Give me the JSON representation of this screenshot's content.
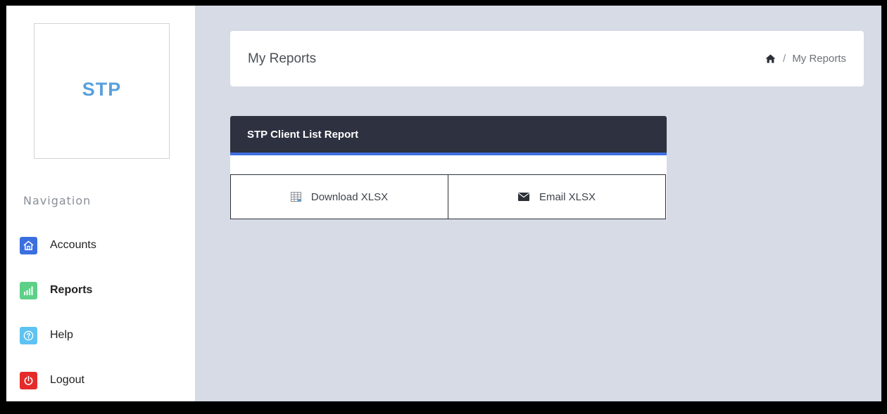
{
  "sidebar": {
    "logo_text": "STP",
    "nav_heading": "Navigation",
    "items": [
      {
        "label": "Accounts",
        "icon": "home-icon",
        "color": "#3b6fe0",
        "active": false
      },
      {
        "label": "Reports",
        "icon": "bar-chart-icon",
        "color": "#5dd087",
        "active": true
      },
      {
        "label": "Help",
        "icon": "help-icon",
        "color": "#5ec3f2",
        "active": false
      },
      {
        "label": "Logout",
        "icon": "power-icon",
        "color": "#e52a2a",
        "active": false
      }
    ]
  },
  "header": {
    "title": "My Reports",
    "breadcrumb_separator": "/",
    "breadcrumb_current": "My Reports"
  },
  "report": {
    "title": "STP Client List Report",
    "download_label": "Download XLSX",
    "email_label": "Email XLSX"
  }
}
